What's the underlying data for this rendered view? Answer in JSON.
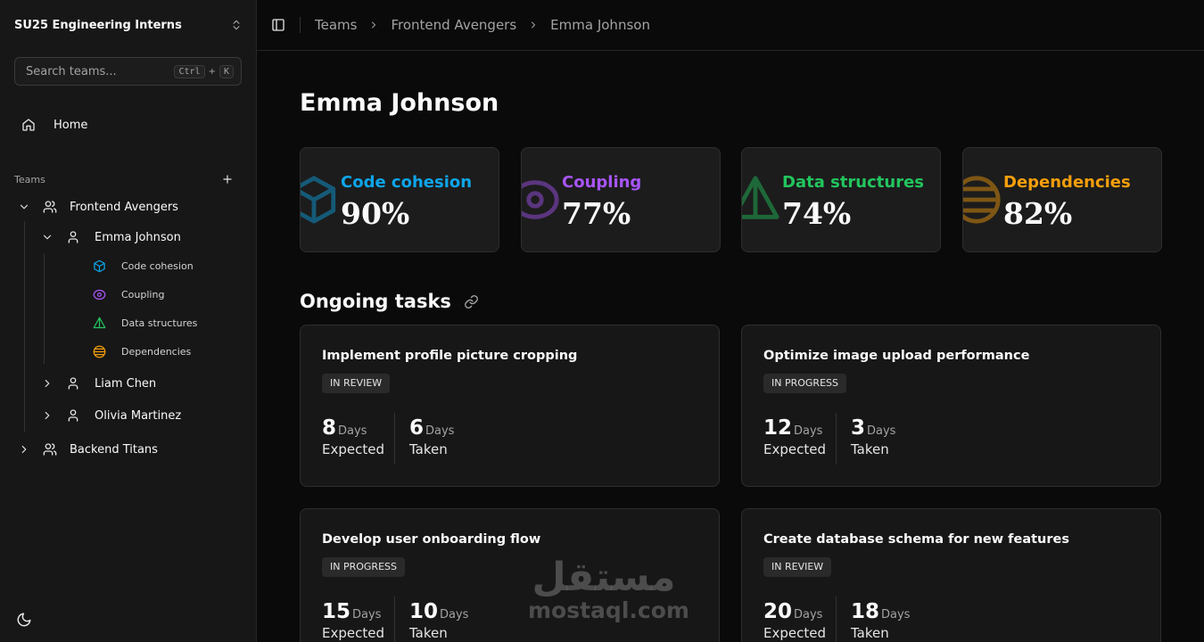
{
  "sidebar": {
    "org_name": "SU25 Engineering Interns",
    "search": {
      "placeholder": "Search teams...",
      "kbd_ctrl": "Ctrl",
      "kbd_plus": "+",
      "kbd_key": "K"
    },
    "home_label": "Home",
    "teams_label": "Teams",
    "teams": [
      {
        "label": "Frontend Avengers",
        "members": [
          {
            "label": "Emma Johnson",
            "metrics": [
              {
                "label": "Code cohesion",
                "icon": "box-icon",
                "color": "#0ea5e9"
              },
              {
                "label": "Coupling",
                "icon": "eye-icon",
                "color": "#a855f7"
              },
              {
                "label": "Data structures",
                "icon": "triangle-icon",
                "color": "#22c55e"
              },
              {
                "label": "Dependencies",
                "icon": "circle-lines-icon",
                "color": "#f59e0b"
              }
            ]
          },
          {
            "label": "Liam Chen"
          },
          {
            "label": "Olivia Martinez"
          }
        ]
      },
      {
        "label": "Backend Titans"
      }
    ]
  },
  "breadcrumb": [
    "Teams",
    "Frontend Avengers",
    "Emma Johnson"
  ],
  "page_title": "Emma Johnson",
  "metrics": [
    {
      "label": "Code cohesion",
      "value": "90%",
      "color": "#0ea5e9"
    },
    {
      "label": "Coupling",
      "value": "77%",
      "color": "#a855f7"
    },
    {
      "label": "Data structures",
      "value": "74%",
      "color": "#22c55e"
    },
    {
      "label": "Dependencies",
      "value": "82%",
      "color": "#f59e0b"
    }
  ],
  "tasks_title": "Ongoing tasks",
  "tasks": [
    {
      "title": "Implement profile picture cropping",
      "status": "IN REVIEW",
      "expected": "8",
      "taken": "6",
      "unit": "Days",
      "expected_label": "Expected",
      "taken_label": "Taken"
    },
    {
      "title": "Optimize image upload performance",
      "status": "IN PROGRESS",
      "expected": "12",
      "taken": "3",
      "unit": "Days",
      "expected_label": "Expected",
      "taken_label": "Taken"
    },
    {
      "title": "Develop user onboarding flow",
      "status": "IN PROGRESS",
      "expected": "15",
      "taken": "10",
      "unit": "Days",
      "expected_label": "Expected",
      "taken_label": "Taken"
    },
    {
      "title": "Create database schema for new features",
      "status": "IN REVIEW",
      "expected": "20",
      "taken": "18",
      "unit": "Days",
      "expected_label": "Expected",
      "taken_label": "Taken"
    }
  ],
  "watermark": {
    "arabic": "مستقل",
    "latin": "mostaql.com"
  }
}
